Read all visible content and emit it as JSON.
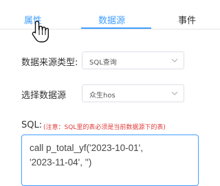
{
  "tabs": {
    "properties": "属性",
    "data_source": "数据源",
    "events": "事件",
    "active": "data_source"
  },
  "form": {
    "source_type_label": "数据来源类型:",
    "source_type_value": "SQL查询",
    "datasource_label": "选择数据源",
    "datasource_value": "众生hos",
    "sql_label": "SQL:",
    "sql_note": "(注意：SQL里的表必须是当前数据源下的表)",
    "sql_value": "call p_total_yf('2023-10-01',\n'2023-11-04', '')"
  },
  "colors": {
    "accent": "#409eff",
    "warning_text": "#e03b3b"
  },
  "icons": {
    "cursor": "hand-pointer-icon",
    "dropdown": "chevron-down-icon"
  }
}
